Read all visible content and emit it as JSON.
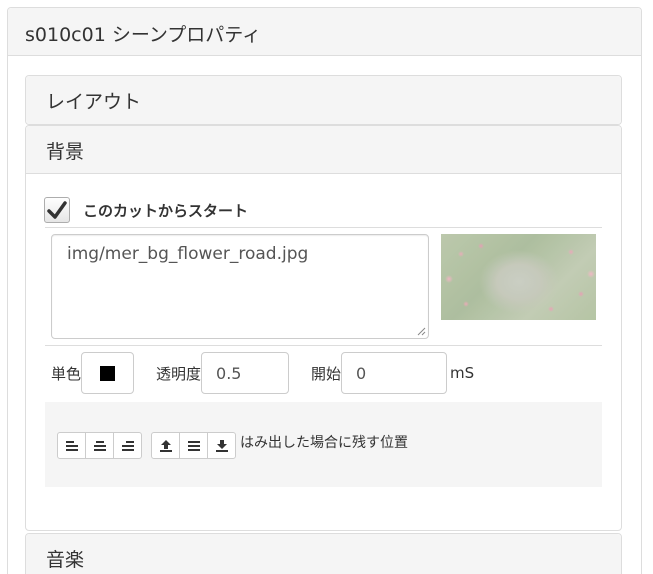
{
  "window": {
    "title": "s010c01 シーンプロパティ"
  },
  "panels": {
    "layout": {
      "label": "レイアウト"
    },
    "background": {
      "label": "背景",
      "start_from_this_cut": {
        "label": "このカットからスタート",
        "checked": true
      },
      "image_path": "img/mer_bg_flower_road.jpg",
      "thumbnail_icon": "background-thumbnail-image",
      "solid_color": {
        "label": "単色",
        "value": "#000000"
      },
      "opacity": {
        "label": "透明度",
        "value": "0.5"
      },
      "start": {
        "label": "開始",
        "value": "0",
        "unit": "mS"
      },
      "overflow_position": {
        "label": "はみ出した場合に残す位置",
        "horizontal_icons": [
          "align-left-icon",
          "align-center-icon",
          "align-right-icon"
        ],
        "vertical_icons": [
          "align-top-icon",
          "align-middle-icon",
          "align-bottom-icon"
        ]
      }
    },
    "music": {
      "label": "音楽"
    }
  }
}
